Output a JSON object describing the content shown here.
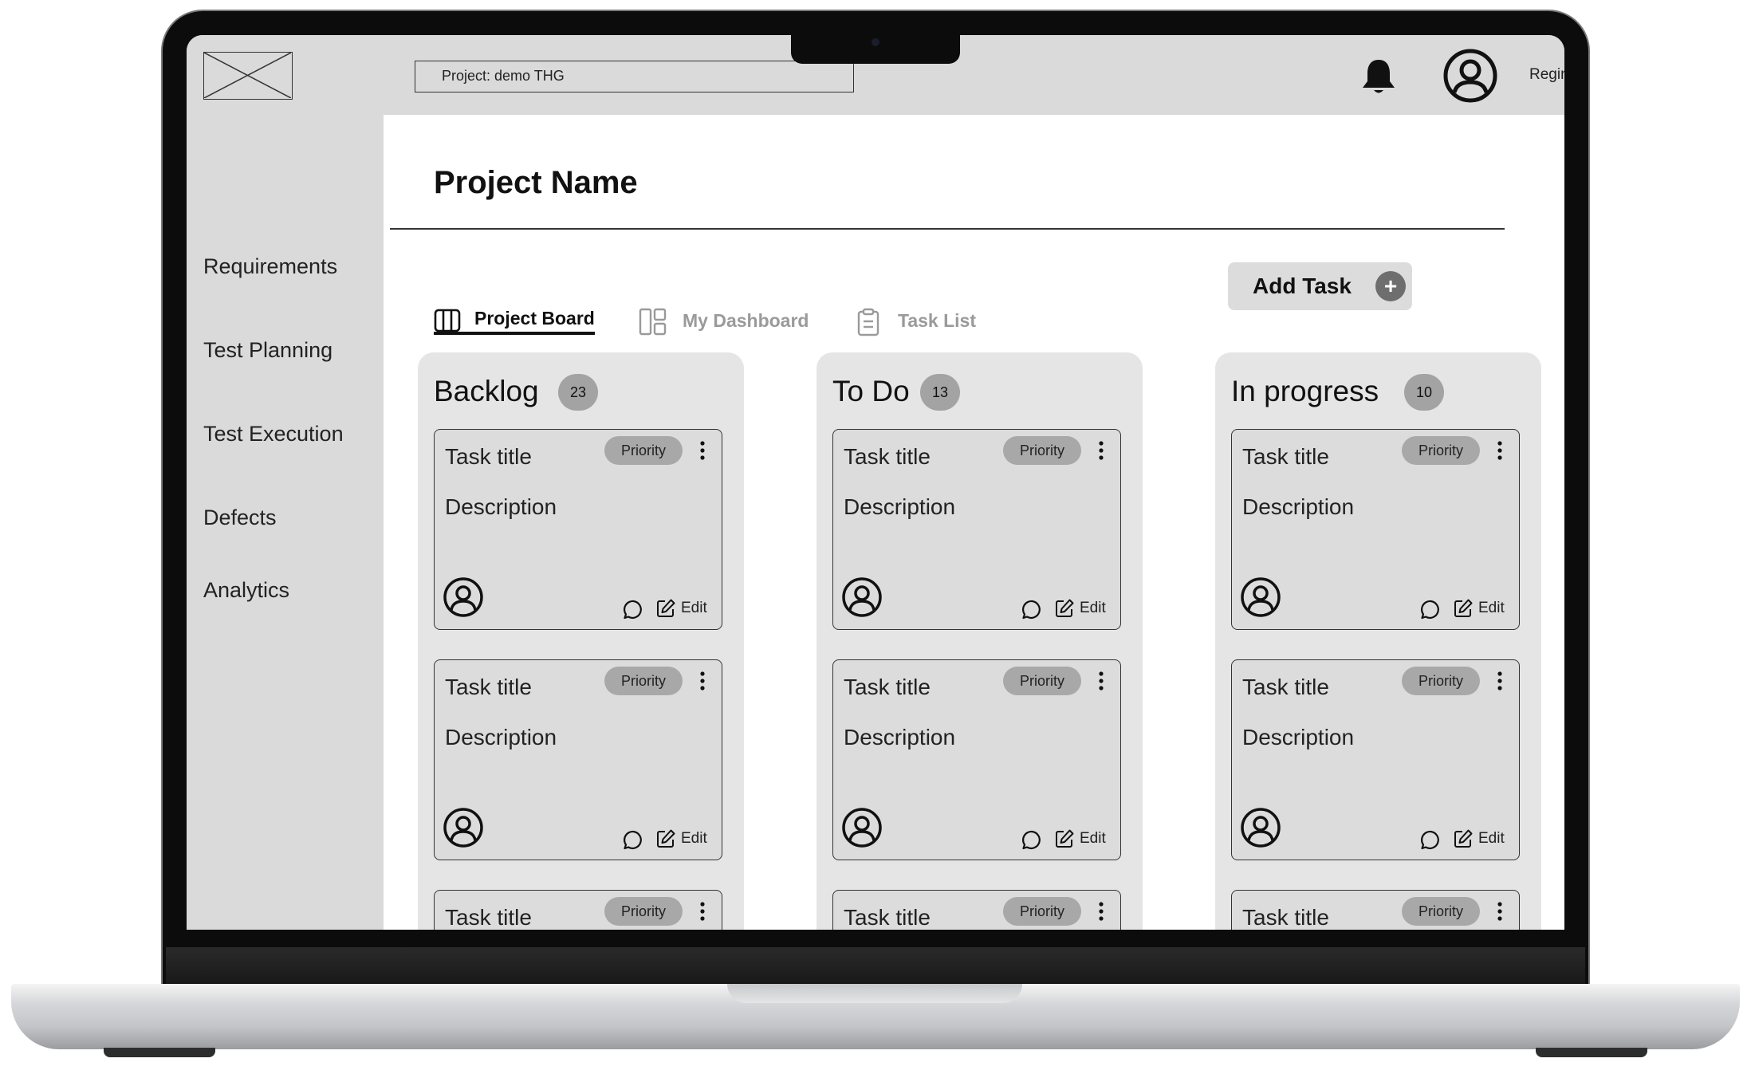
{
  "header": {
    "project_field": "Project: demo THG",
    "user_name": "Regine, T"
  },
  "sidebar": {
    "items": [
      {
        "label": "Requirements"
      },
      {
        "label": "Test Planning"
      },
      {
        "label": "Test Execution"
      },
      {
        "label": "Defects"
      },
      {
        "label": "Analytics"
      }
    ]
  },
  "main": {
    "title": "Project Name",
    "add_task_label": "Add Task",
    "add_task_icon": "+",
    "tabs": [
      {
        "label": "Project Board",
        "icon": "board-icon",
        "active": true
      },
      {
        "label": "My Dashboard",
        "icon": "dashboard-icon",
        "active": false
      },
      {
        "label": "Task List",
        "icon": "clipboard-icon",
        "active": false
      }
    ]
  },
  "board": {
    "columns": [
      {
        "title": "Backlog",
        "count": "23"
      },
      {
        "title": "To Do",
        "count": "13"
      },
      {
        "title": "In progress",
        "count": "10"
      }
    ],
    "card": {
      "title": "Task title",
      "description": "Description",
      "priority": "Priority",
      "edit_label": "Edit"
    }
  },
  "colors": {
    "sidebar_bg": "#dadada",
    "column_bg": "#e5e5e5",
    "card_bg": "#dcdcdc",
    "badge_bg": "#a3a3a3",
    "add_task_bg": "#dcdcdc"
  }
}
